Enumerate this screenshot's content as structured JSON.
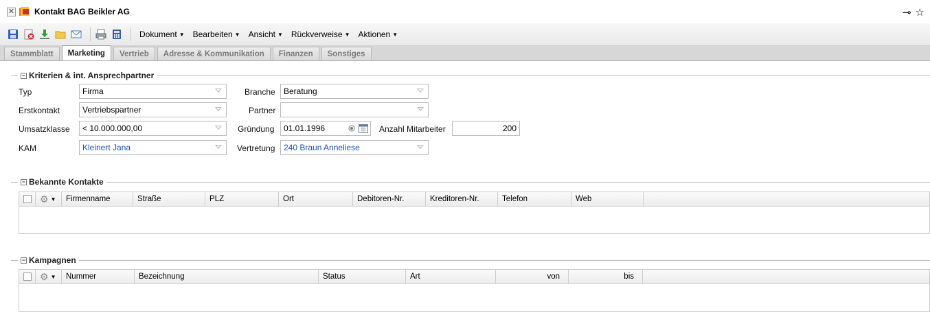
{
  "window": {
    "title": "Kontakt BAG Beikler AG",
    "pin_glyph": "⊸",
    "star_glyph": "☆"
  },
  "toolbar": {
    "menus": [
      "Dokument",
      "Bearbeiten",
      "Ansicht",
      "Rückverweise",
      "Aktionen"
    ]
  },
  "tabs": [
    {
      "label": "Stammblatt",
      "active": false
    },
    {
      "label": "Marketing",
      "active": true
    },
    {
      "label": "Vertrieb",
      "active": false
    },
    {
      "label": "Adresse & Kommunikation",
      "active": false
    },
    {
      "label": "Finanzen",
      "active": false
    },
    {
      "label": "Sonstiges",
      "active": false
    }
  ],
  "kriterien": {
    "legend": "Kriterien & int. Ansprechpartner",
    "typ": {
      "label": "Typ",
      "value": "Firma"
    },
    "erstkontakt": {
      "label": "Erstkontakt",
      "value": "Vertriebspartner"
    },
    "umsatzklasse": {
      "label": "Umsatzklasse",
      "value": "< 10.000.000,00"
    },
    "kam": {
      "label": "KAM",
      "value": "Kleinert Jana"
    },
    "branche": {
      "label": "Branche",
      "value": "Beratung"
    },
    "partner": {
      "label": "Partner",
      "value": ""
    },
    "gruendung": {
      "label": "Gründung",
      "value": "01.01.1996"
    },
    "vertretung": {
      "label": "Vertretung",
      "value": "240 Braun Anneliese"
    },
    "anzahl": {
      "label": "Anzahl Mitarbeiter",
      "value": "200"
    }
  },
  "kontakte": {
    "legend": "Bekannte Kontakte",
    "columns": [
      "Firmenname",
      "Straße",
      "PLZ",
      "Ort",
      "Debitoren-Nr.",
      "Kreditoren-Nr.",
      "Telefon",
      "Web"
    ]
  },
  "kampagnen": {
    "legend": "Kampagnen",
    "columns": [
      "Nummer",
      "Bezeichnung",
      "Status",
      "Art",
      "von",
      "bis"
    ]
  },
  "colors": {
    "link": "#1f4fb8",
    "fieldset_line": "#b5bdd0"
  }
}
